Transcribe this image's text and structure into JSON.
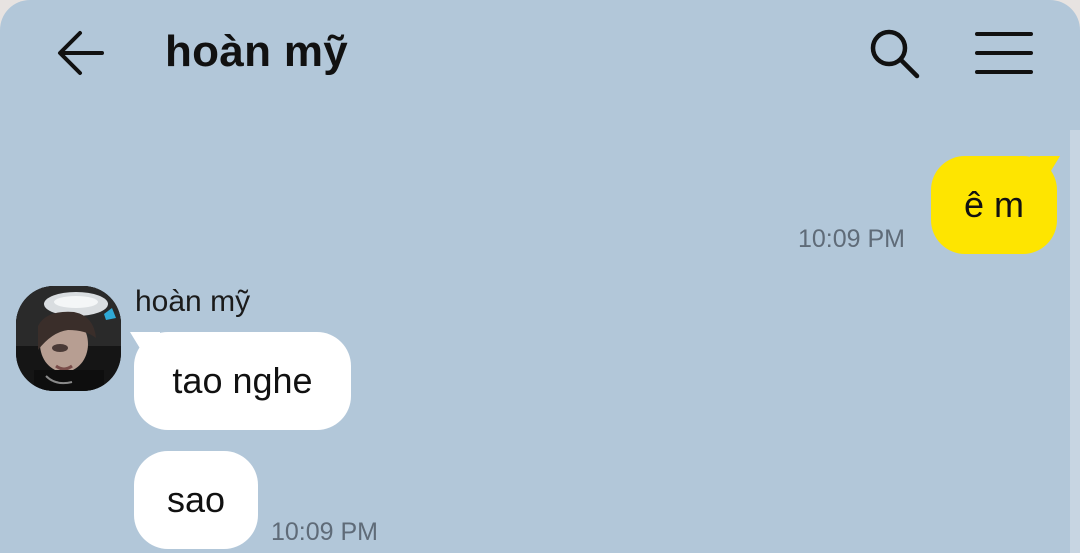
{
  "header": {
    "title": "hoàn mỹ",
    "back_icon": "arrow-left-icon",
    "search_icon": "search-icon",
    "menu_icon": "menu-icon"
  },
  "messages": {
    "outgoing": [
      {
        "text": "ê m",
        "time": "10:09 PM"
      }
    ],
    "incoming_group": {
      "sender": "hoàn mỹ",
      "avatar": "profile-photo",
      "items": [
        {
          "text": "tao nghe"
        },
        {
          "text": "sao"
        }
      ],
      "time": "10:09 PM"
    }
  },
  "colors": {
    "chat_background": "#b2c7d9",
    "outgoing_bubble": "#fee500",
    "incoming_bubble": "#ffffff"
  }
}
